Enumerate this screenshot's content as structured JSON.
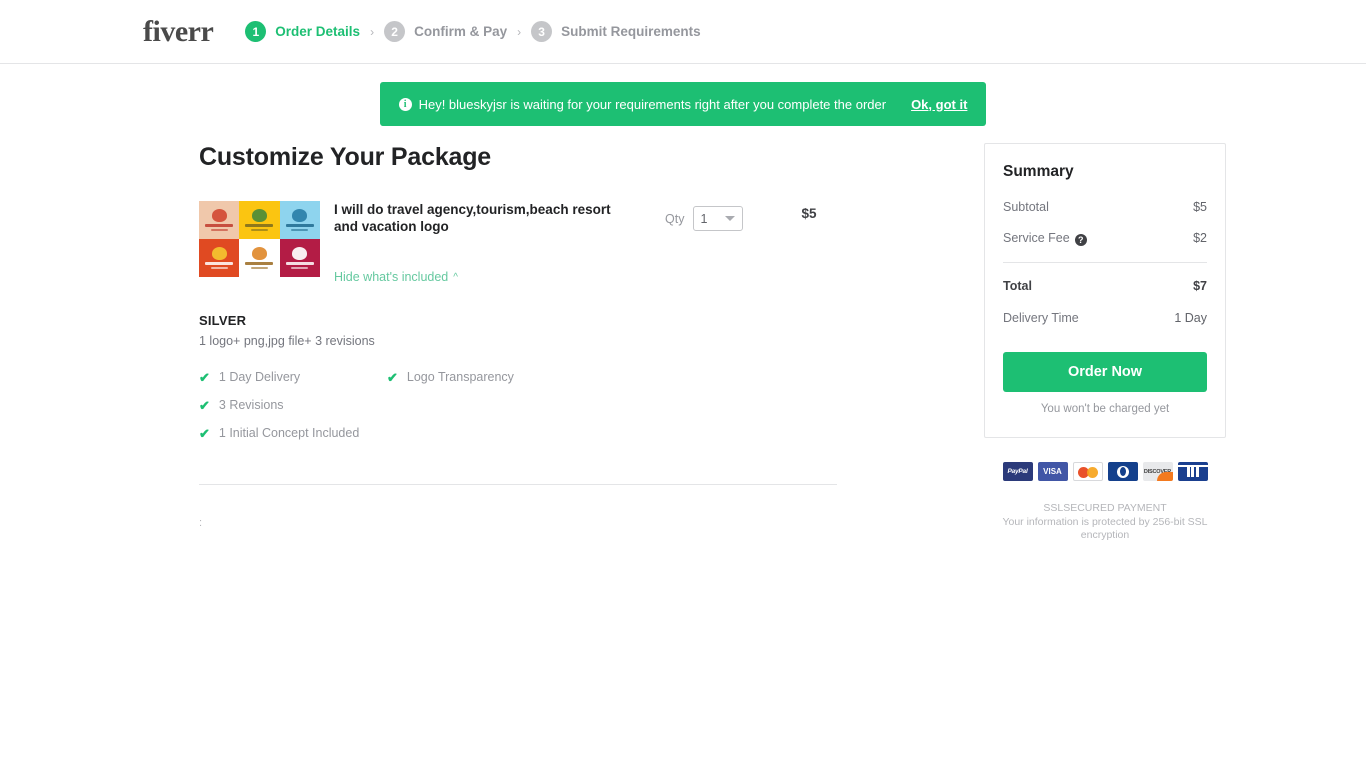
{
  "header": {
    "logo": "fiverr",
    "steps": [
      {
        "number": "1",
        "label": "Order Details",
        "state": "active"
      },
      {
        "number": "2",
        "label": "Confirm & Pay",
        "state": "inactive"
      },
      {
        "number": "3",
        "label": "Submit Requirements",
        "state": "inactive"
      }
    ],
    "separator": "›"
  },
  "banner": {
    "icon": "info-icon",
    "icon_glyph": "i",
    "text": "Hey! blueskyjsr is waiting for your requirements right after you complete the order",
    "link_label": "Ok, got it",
    "background_color": "#1dbf73"
  },
  "main": {
    "title": "Customize Your Package",
    "gig": {
      "title": "I will do travel agency,tourism,beach resort and vacation logo",
      "hide_link": "Hide what's included",
      "hide_chevron": "˄",
      "qty_label": "Qty",
      "qty_value": "1",
      "price": "$5",
      "thumbnail_cells": [
        {
          "bg": "#f0c8ab",
          "mark": "#d34a33",
          "text": "#c0392b"
        },
        {
          "bg": "#fbc511",
          "mark": "#4d8b3a",
          "text": "#7a6a1e"
        },
        {
          "bg": "#8ed4ee",
          "mark": "#2a7fa8",
          "text": "#1f6a8e"
        },
        {
          "bg": "#e04a22",
          "mark": "#f4c430",
          "text": "#ffffff"
        },
        {
          "bg": "#ffffff",
          "mark": "#e08a2e",
          "text": "#9a6a20"
        },
        {
          "bg": "#b31c45",
          "mark": "#ffffff",
          "text": "#ffffff"
        }
      ]
    },
    "package": {
      "name": "SILVER",
      "description": "1 logo+ png,jpg file+ 3 revisions",
      "features": [
        "1 Day Delivery",
        "Logo Transparency",
        "3 Revisions",
        "1 Initial Concept Included"
      ],
      "check_glyph": "✔",
      "accent_color": "#1dbf73"
    },
    "stray_text": ":"
  },
  "summary": {
    "title": "Summary",
    "rows": [
      {
        "label": "Subtotal",
        "value": "$5"
      },
      {
        "label": "Service Fee",
        "value": "$2",
        "help": "?"
      }
    ],
    "total_label": "Total",
    "total_value": "$7",
    "delivery_label": "Delivery Time",
    "delivery_value": "1 Day",
    "order_button": "Order Now",
    "no_charge_note": "You won't be charged yet",
    "payments": [
      {
        "name": "paypal",
        "label": "PayPal"
      },
      {
        "name": "visa",
        "label": "VISA"
      },
      {
        "name": "mastercard",
        "label": ""
      },
      {
        "name": "diners",
        "label": ""
      },
      {
        "name": "discover",
        "label": "DISCOVER"
      },
      {
        "name": "ach",
        "label": ""
      }
    ],
    "ssl_line1": "SSLSECURED PAYMENT",
    "ssl_line2": "Your information is protected by 256-bit SSL encryption"
  }
}
